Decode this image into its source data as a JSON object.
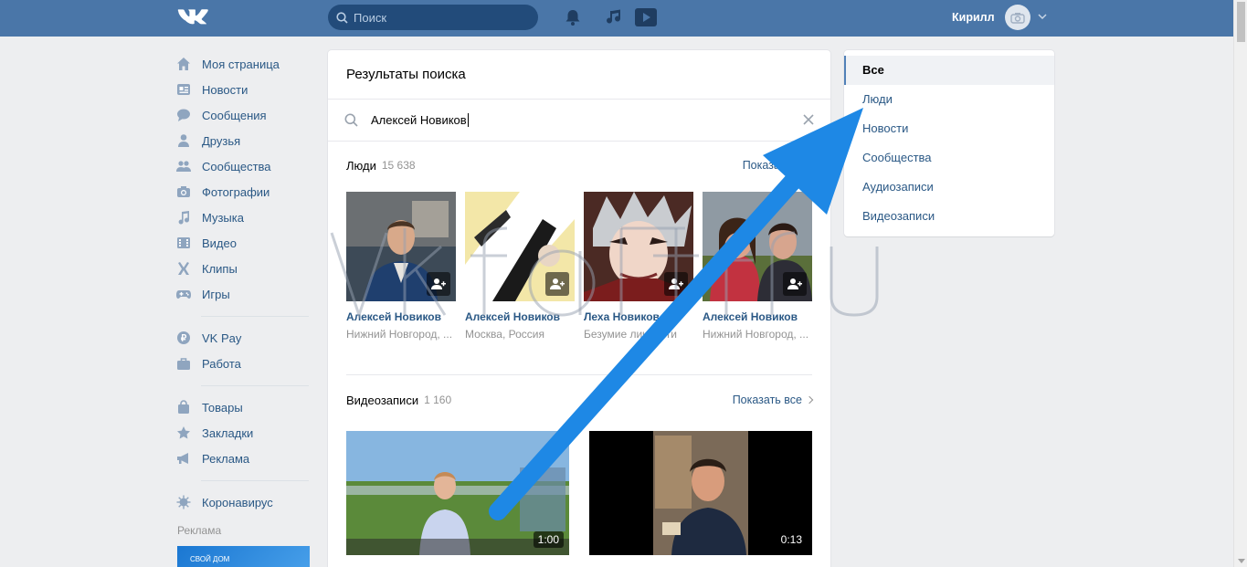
{
  "topbar": {
    "logo": "vk-logo",
    "search_placeholder": "Поиск",
    "username": "Кирилл",
    "icons": [
      "search-icon",
      "bell-icon",
      "music-icon",
      "video-play-icon",
      "camera-icon",
      "chevron-down-icon"
    ]
  },
  "leftnav": {
    "items": [
      {
        "label": "Моя страница",
        "icon": "home-icon"
      },
      {
        "label": "Новости",
        "icon": "news-icon"
      },
      {
        "label": "Сообщения",
        "icon": "messages-icon"
      },
      {
        "label": "Друзья",
        "icon": "friends-icon"
      },
      {
        "label": "Сообщества",
        "icon": "communities-icon"
      },
      {
        "label": "Фотографии",
        "icon": "camera-icon"
      },
      {
        "label": "Музыка",
        "icon": "music-icon"
      },
      {
        "label": "Видео",
        "icon": "video-icon"
      },
      {
        "label": "Клипы",
        "icon": "clips-icon"
      },
      {
        "label": "Игры",
        "icon": "gamepad-icon"
      }
    ],
    "items2": [
      {
        "label": "VK Pay",
        "icon": "vkpay-icon"
      },
      {
        "label": "Работа",
        "icon": "briefcase-icon"
      }
    ],
    "items3": [
      {
        "label": "Товары",
        "icon": "bag-icon"
      },
      {
        "label": "Закладки",
        "icon": "star-icon"
      },
      {
        "label": "Реклама",
        "icon": "megaphone-icon"
      }
    ],
    "items4": [
      {
        "label": "Коронавирус",
        "icon": "virus-icon"
      }
    ],
    "ads_label": "Реклама",
    "ad_text": "СВОЙ ДОМ"
  },
  "main": {
    "title": "Результаты поиска",
    "query": "Алексей Новиков",
    "people": {
      "title": "Люди",
      "count": "15 638",
      "show_all": "Показать все",
      "items": [
        {
          "name": "Алексей Новиков",
          "city": "Нижний Новгород, ..."
        },
        {
          "name": "Алексей Новиков",
          "city": "Москва, Россия"
        },
        {
          "name": "Леха Новиков",
          "city": "Безумие личности"
        },
        {
          "name": "Алексей Новиков",
          "city": "Нижний Новгород, ..."
        }
      ]
    },
    "videos": {
      "title": "Видеозаписи",
      "count": "1 160",
      "show_all": "Показать все",
      "items": [
        {
          "duration": "1:00"
        },
        {
          "duration": "0:13"
        }
      ]
    }
  },
  "filters": {
    "items": [
      "Все",
      "Люди",
      "Новости",
      "Сообщества",
      "Аудиозаписи",
      "Видеозаписи"
    ],
    "active": "Все"
  },
  "colors": {
    "header_bg": "#4a76a8",
    "link": "#2a5885",
    "page_bg": "#edeef0",
    "arrow": "#1e88e5"
  }
}
